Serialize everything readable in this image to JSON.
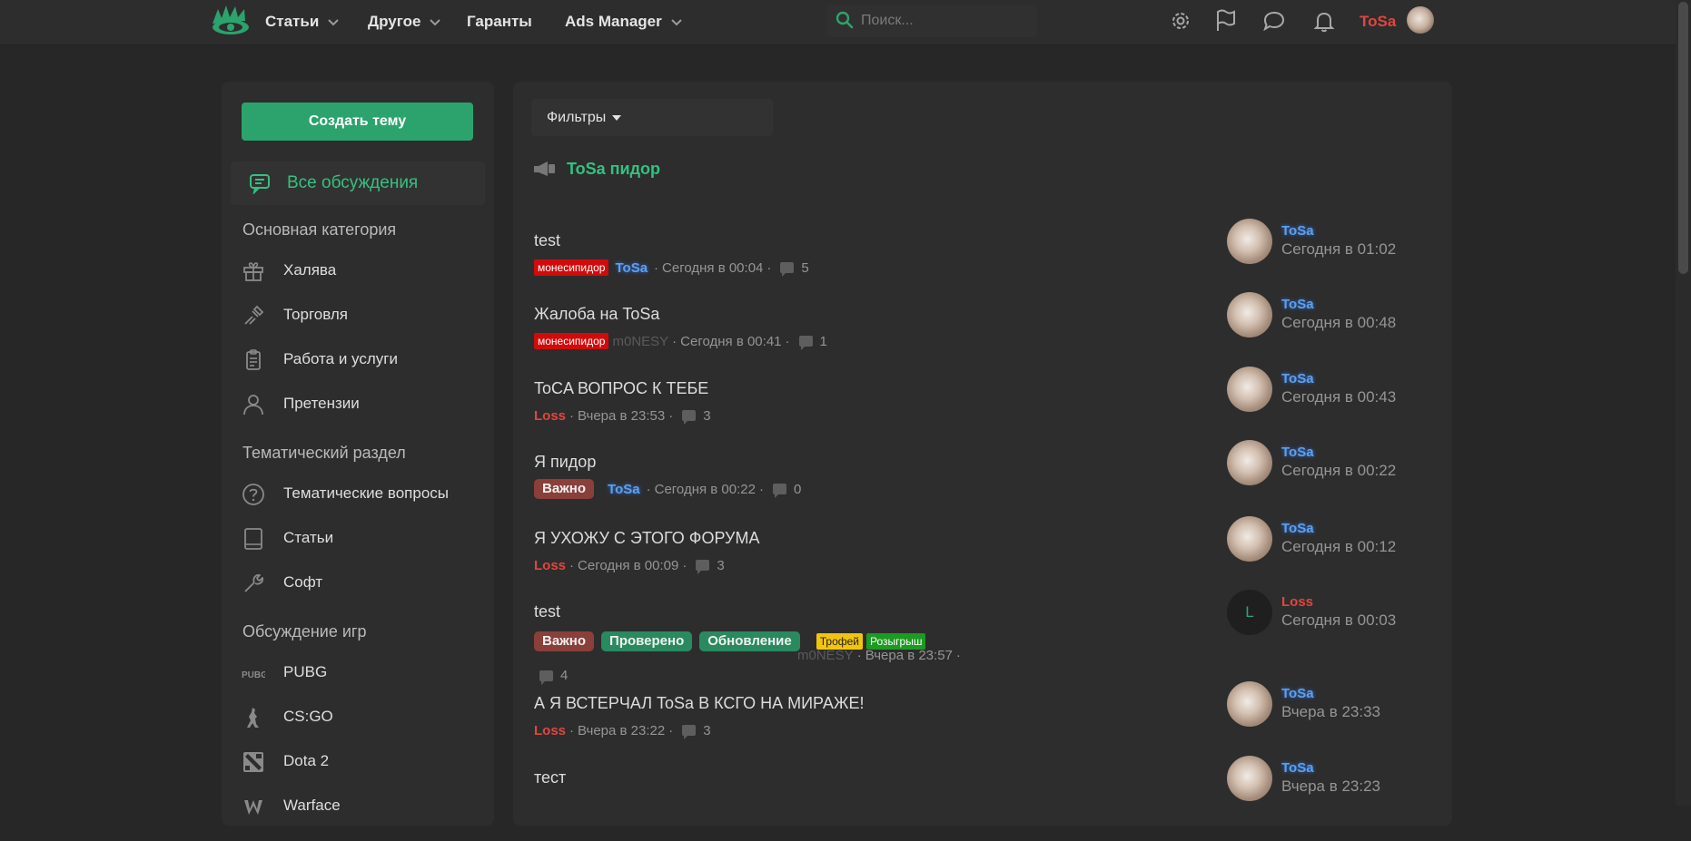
{
  "nav": {
    "items": [
      {
        "label": "Статьи",
        "has_dropdown": true
      },
      {
        "label": "Другое",
        "has_dropdown": true
      },
      {
        "label": "Гаранты",
        "has_dropdown": false
      },
      {
        "label": "Ads Manager",
        "has_dropdown": true
      }
    ],
    "search_placeholder": "Поиск...",
    "username": "ToSa",
    "icons": [
      "settings-icon",
      "flag-icon",
      "chat-icon",
      "bell-icon"
    ]
  },
  "sidebar": {
    "create_label": "Создать тему",
    "all_discussions": "Все обсуждения",
    "sections": [
      {
        "heading": "Основная категория",
        "items": [
          {
            "label": "Халява",
            "icon": "gift-icon"
          },
          {
            "label": "Торговля",
            "icon": "trade-icon"
          },
          {
            "label": "Работа и услуги",
            "icon": "clipboard-icon"
          },
          {
            "label": "Претензии",
            "icon": "user-icon"
          }
        ]
      },
      {
        "heading": "Тематический раздел",
        "items": [
          {
            "label": "Тематические вопросы",
            "icon": "question-icon"
          },
          {
            "label": "Статьи",
            "icon": "book-icon"
          },
          {
            "label": "Софт",
            "icon": "wrench-icon"
          }
        ]
      },
      {
        "heading": "Обсуждение игр",
        "items": [
          {
            "label": "PUBG",
            "icon": "pubg-icon"
          },
          {
            "label": "CS:GO",
            "icon": "csgo-icon"
          },
          {
            "label": "Dota 2",
            "icon": "dota-icon"
          },
          {
            "label": "Warface",
            "icon": "warface-icon"
          }
        ]
      }
    ]
  },
  "main": {
    "filters_label": "Фильтры",
    "announcement": "ToSa пидор",
    "threads": [
      {
        "title": "test",
        "tags": [
          {
            "text": "монесипидор",
            "style": "red"
          }
        ],
        "author": "ToSa",
        "author_style": "tosa",
        "date": "Сегодня в 00:04",
        "replies": "5",
        "last_user": "ToSa",
        "last_style": "tosa",
        "last_time": "Сегодня в 01:02",
        "last_avatar": "photo"
      },
      {
        "title": "Жалоба на ToSa",
        "tags": [
          {
            "text": "монесипидор",
            "style": "red"
          }
        ],
        "author": "m0NESY",
        "author_style": "m0",
        "date": "Сегодня в 00:41",
        "replies": "1",
        "last_user": "ToSa",
        "last_style": "tosa",
        "last_time": "Сегодня в 00:48",
        "last_avatar": "photo"
      },
      {
        "title": "ToCA ВОПРОС К ТЕБЕ",
        "tags": [],
        "author": "Loss",
        "author_style": "loss",
        "date": "Вчера в 23:53",
        "replies": "3",
        "last_user": "ToSa",
        "last_style": "tosa",
        "last_time": "Сегодня в 00:43",
        "last_avatar": "photo"
      },
      {
        "title": "Я пидор",
        "tags": [
          {
            "text": "Важно",
            "style": "imp"
          }
        ],
        "author": "ToSa",
        "author_style": "tosa",
        "date": "Сегодня в 00:22",
        "replies": "0",
        "last_user": "ToSa",
        "last_style": "tosa",
        "last_time": "Сегодня в 00:22",
        "last_avatar": "photo"
      },
      {
        "title": "Я УХОЖУ С ЭТОГО ФОРУМА",
        "tags": [],
        "author": "Loss",
        "author_style": "loss",
        "date": "Сегодня в 00:09",
        "replies": "3",
        "last_user": "ToSa",
        "last_style": "tosa",
        "last_time": "Сегодня в 00:12",
        "last_avatar": "photo"
      },
      {
        "title": "test",
        "tags": [
          {
            "text": "Важно",
            "style": "imp"
          },
          {
            "text": "Проверено",
            "style": "green"
          },
          {
            "text": "Обновление",
            "style": "green"
          },
          {
            "text": "Трофей",
            "style": "yellow"
          },
          {
            "text": "Розыгрыш",
            "style": "dgreen"
          }
        ],
        "author": "m0NESY",
        "author_style": "m0",
        "date": "Вчера в 23:57",
        "replies": "4",
        "last_user": "Loss",
        "last_style": "loss",
        "last_time": "Сегодня в 00:03",
        "last_avatar": "L"
      },
      {
        "title": "А Я ВСТЕРЧАЛ ToSa В КСГО НА МИРАЖЕ!",
        "tags": [],
        "author": "Loss",
        "author_style": "loss",
        "date": "Вчера в 23:22",
        "replies": "3",
        "last_user": "ToSa",
        "last_style": "tosa",
        "last_time": "Вчера в 23:33",
        "last_avatar": "photo"
      },
      {
        "title": "тест",
        "tags": [],
        "author": "",
        "author_style": "",
        "date": "",
        "replies": "",
        "last_user": "ToSa",
        "last_style": "tosa",
        "last_time": "Вчера в 23:23",
        "last_avatar": "photo"
      }
    ]
  }
}
